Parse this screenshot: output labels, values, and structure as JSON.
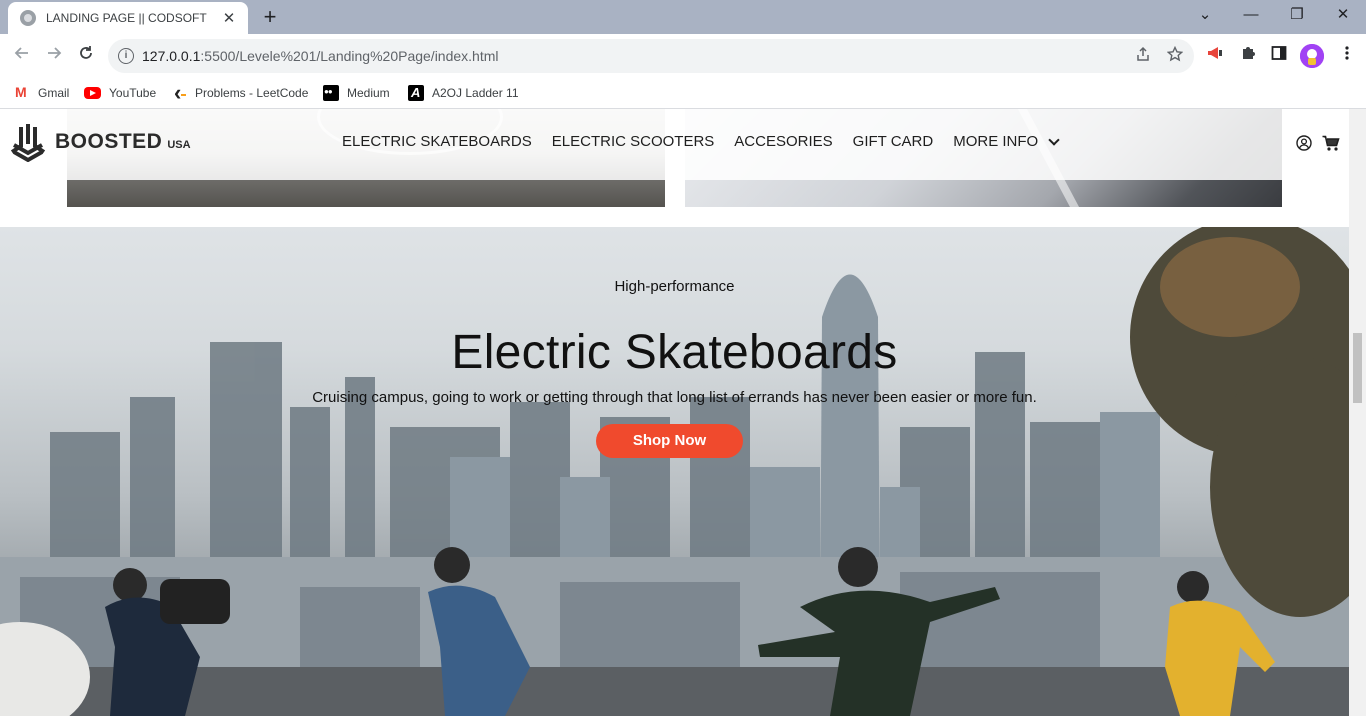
{
  "browser": {
    "tab_title": "LANDING PAGE || CODSOFT",
    "tab_close": "✕",
    "new_tab": "+",
    "url_host": "127.0.0.1",
    "url_rest": ":5500/Levele%201/Landing%20Page/index.html",
    "window_controls": {
      "minimize": "—",
      "restore": "❐",
      "close": "✕",
      "tabs_menu": "⌄"
    },
    "bookmarks": [
      {
        "label": "Gmail",
        "icon": "gmail-icon"
      },
      {
        "label": "YouTube",
        "icon": "youtube-icon"
      },
      {
        "label": "Problems - LeetCode",
        "icon": "leetcode-icon"
      },
      {
        "label": "Medium",
        "icon": "medium-icon"
      },
      {
        "label": "A2OJ Ladder 11",
        "icon": "a2oj-icon"
      }
    ]
  },
  "site": {
    "logo": {
      "word": "BOOSTED",
      "sub": "USA"
    },
    "nav": [
      "ELECTRIC SKATEBOARDS",
      "ELECTRIC SCOOTERS",
      "ACCESORIES",
      "GIFT CARD",
      "MORE INFO"
    ]
  },
  "hero": {
    "kicker": "High-performance",
    "title": "Electric Skateboards",
    "description": "Cruising campus, going to work or getting through that long list of errands has never been easier or more fun.",
    "button": "Shop Now",
    "accent_color": "#f04a2d"
  }
}
